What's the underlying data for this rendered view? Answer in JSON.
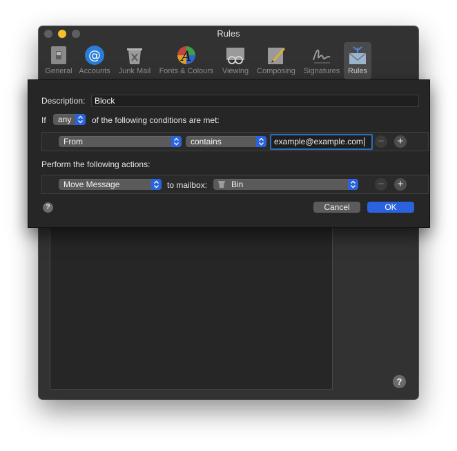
{
  "window": {
    "title": "Rules"
  },
  "toolbar": {
    "items": [
      {
        "label": "General",
        "icon": "light-switch-icon"
      },
      {
        "label": "Accounts",
        "icon": "at-sign-icon"
      },
      {
        "label": "Junk Mail",
        "icon": "junk-bin-icon"
      },
      {
        "label": "Fonts & Colours",
        "icon": "palette-icon"
      },
      {
        "label": "Viewing",
        "icon": "glasses-icon"
      },
      {
        "label": "Composing",
        "icon": "pencil-icon"
      },
      {
        "label": "Signatures",
        "icon": "signature-icon"
      },
      {
        "label": "Rules",
        "icon": "rules-envelope-icon"
      }
    ],
    "active": "Rules"
  },
  "sheet": {
    "description_label": "Description:",
    "description_value": "Block",
    "if_label": "If",
    "match_select": "any",
    "conditions_suffix": "of the following conditions are met:",
    "condition": {
      "field": "From",
      "operator": "contains",
      "value": "example@example.com"
    },
    "actions_label": "Perform the following actions:",
    "action": {
      "type": "Move Message",
      "to_label": "to mailbox:",
      "mailbox": "Bin"
    },
    "remove_symbol": "−",
    "add_symbol": "+",
    "help_symbol": "?",
    "cancel_label": "Cancel",
    "ok_label": "OK"
  },
  "help_symbol": "?",
  "colors": {
    "accent": "#2a63dd",
    "focus_ring": "#2c6fbf",
    "minimize": "#f5bf2f"
  }
}
